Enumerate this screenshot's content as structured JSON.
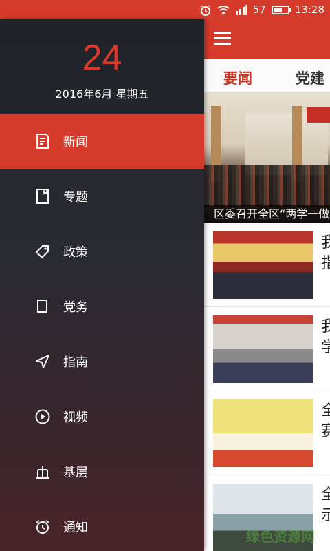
{
  "status_bar": {
    "signal_percent": "57",
    "time": "13:28",
    "battery_level": 0.6,
    "icons": [
      "alarm-icon",
      "wifi-icon",
      "signal-icon",
      "battery-icon"
    ]
  },
  "drawer": {
    "date_day": "24",
    "date_line": "2016年6月  星期五",
    "items": [
      {
        "label": "新闻",
        "icon": "news-icon",
        "active": true
      },
      {
        "label": "专题",
        "icon": "topic-icon",
        "active": false
      },
      {
        "label": "政策",
        "icon": "policy-icon",
        "active": false
      },
      {
        "label": "党务",
        "icon": "party-icon",
        "active": false
      },
      {
        "label": "指南",
        "icon": "guide-icon",
        "active": false
      },
      {
        "label": "视频",
        "icon": "video-icon",
        "active": false
      },
      {
        "label": "基层",
        "icon": "grassroots-icon",
        "active": false
      },
      {
        "label": "通知",
        "icon": "notice-icon",
        "active": false
      }
    ]
  },
  "main": {
    "tabs": [
      {
        "label": "要闻",
        "active": true
      },
      {
        "label": "党建",
        "active": false
      }
    ],
    "hero_caption": "区委召开全区“两学一做",
    "news": [
      {
        "title_fragment": "我指"
      },
      {
        "title_fragment": "我学"
      },
      {
        "title_fragment": "全赛"
      },
      {
        "title_fragment": "全示"
      }
    ]
  },
  "colors": {
    "accent": "#d63a2a",
    "drawer_top": "#1f2229",
    "drawer_bottom": "#4a232a"
  }
}
